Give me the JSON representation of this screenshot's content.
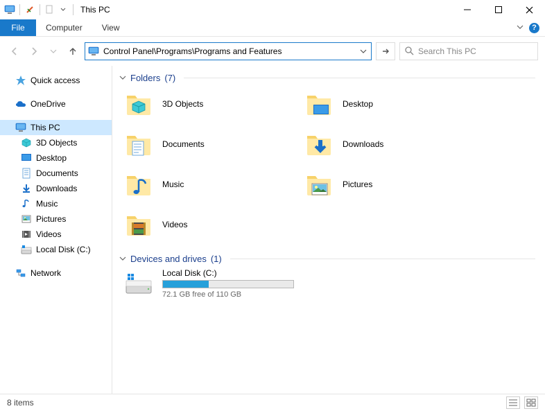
{
  "titlebar": {
    "title": "This PC"
  },
  "menu": {
    "file": "File",
    "computer": "Computer",
    "view": "View"
  },
  "address": {
    "path": "Control Panel\\Programs\\Programs and Features"
  },
  "search": {
    "placeholder": "Search This PC"
  },
  "nav": {
    "quick_access": "Quick access",
    "onedrive": "OneDrive",
    "this_pc": "This PC",
    "children": {
      "objects_3d": "3D Objects",
      "desktop": "Desktop",
      "documents": "Documents",
      "downloads": "Downloads",
      "music": "Music",
      "pictures": "Pictures",
      "videos": "Videos",
      "local_disk": "Local Disk (C:)"
    },
    "network": "Network"
  },
  "groups": {
    "folders": {
      "title": "Folders",
      "count": "(7)"
    },
    "devices": {
      "title": "Devices and drives",
      "count": "(1)"
    }
  },
  "folders": {
    "objects_3d": "3D Objects",
    "desktop": "Desktop",
    "documents": "Documents",
    "downloads": "Downloads",
    "music": "Music",
    "pictures": "Pictures",
    "videos": "Videos"
  },
  "drive": {
    "name": "Local Disk (C:)",
    "free_text": "72.1 GB free of 110 GB",
    "fill_percent": 35
  },
  "status": {
    "items": "8 items"
  }
}
